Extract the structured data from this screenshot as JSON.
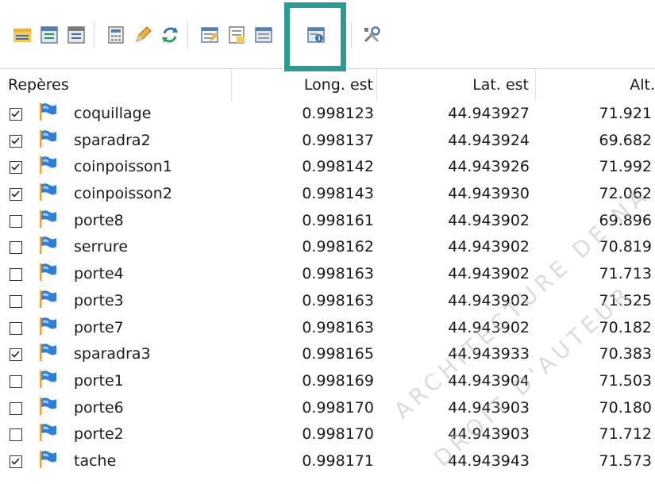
{
  "toolbar": {
    "buttons": [
      {
        "icon": "open-folder-icon"
      },
      {
        "icon": "table-export-icon"
      },
      {
        "icon": "table-import-icon"
      },
      {
        "icon": "calculator-icon"
      },
      {
        "icon": "pencil-icon"
      },
      {
        "icon": "refresh-icon"
      },
      {
        "icon": "edit-list-icon"
      },
      {
        "icon": "list-highlight-icon"
      },
      {
        "icon": "list-info-icon"
      },
      {
        "icon": "tools-icon"
      }
    ],
    "highlight_color": "#2b9b93"
  },
  "columns": {
    "name": "Repères",
    "lon": "Long. est",
    "lat": "Lat. est",
    "alt": "Alt."
  },
  "rows": [
    {
      "checked": true,
      "name": "coquillage",
      "lon": "0.998123",
      "lat": "44.943927",
      "alt": "71.921"
    },
    {
      "checked": true,
      "name": "sparadra2",
      "lon": "0.998137",
      "lat": "44.943924",
      "alt": "69.682"
    },
    {
      "checked": true,
      "name": "coinpoisson1",
      "lon": "0.998142",
      "lat": "44.943926",
      "alt": "71.992"
    },
    {
      "checked": true,
      "name": "coinpoisson2",
      "lon": "0.998143",
      "lat": "44.943930",
      "alt": "72.062"
    },
    {
      "checked": false,
      "name": "porte8",
      "lon": "0.998161",
      "lat": "44.943902",
      "alt": "69.896"
    },
    {
      "checked": false,
      "name": "serrure",
      "lon": "0.998162",
      "lat": "44.943902",
      "alt": "70.819"
    },
    {
      "checked": false,
      "name": "porte4",
      "lon": "0.998163",
      "lat": "44.943902",
      "alt": "71.713"
    },
    {
      "checked": false,
      "name": "porte3",
      "lon": "0.998163",
      "lat": "44.943902",
      "alt": "71.525"
    },
    {
      "checked": false,
      "name": "porte7",
      "lon": "0.998163",
      "lat": "44.943902",
      "alt": "70.182"
    },
    {
      "checked": true,
      "name": "sparadra3",
      "lon": "0.998165",
      "lat": "44.943933",
      "alt": "70.383"
    },
    {
      "checked": false,
      "name": "porte1",
      "lon": "0.998169",
      "lat": "44.943904",
      "alt": "71.503"
    },
    {
      "checked": false,
      "name": "porte6",
      "lon": "0.998170",
      "lat": "44.943903",
      "alt": "70.180"
    },
    {
      "checked": false,
      "name": "porte2",
      "lon": "0.998170",
      "lat": "44.943903",
      "alt": "71.712"
    },
    {
      "checked": true,
      "name": "tache",
      "lon": "0.998171",
      "lat": "44.943943",
      "alt": "71.573"
    }
  ],
  "watermark": {
    "line1": "ARCHITECTURE DE NA",
    "line2": "DROIT D'AUTEUR"
  },
  "colors": {
    "flag_blue": "#2f7fd6",
    "flag_pole": "#e8a33b",
    "check": "#1a1a1a"
  }
}
